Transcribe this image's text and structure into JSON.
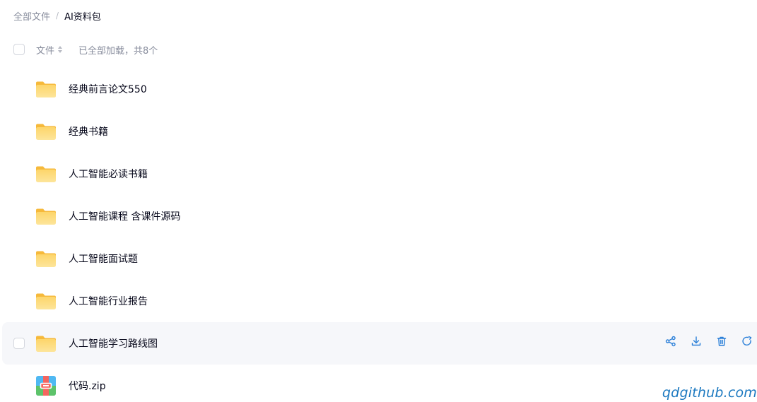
{
  "breadcrumb": {
    "parent": "全部文件",
    "separator": "/",
    "current": "AI资料包"
  },
  "header": {
    "file_column": "文件",
    "status": "已全部加载，共8个"
  },
  "files": [
    {
      "name": "经典前言论文550",
      "type": "folder"
    },
    {
      "name": "经典书籍",
      "type": "folder"
    },
    {
      "name": "人工智能必读书籍",
      "type": "folder"
    },
    {
      "name": "人工智能课程 含课件源码",
      "type": "folder"
    },
    {
      "name": "人工智能面试题",
      "type": "folder"
    },
    {
      "name": "人工智能行业报告",
      "type": "folder"
    },
    {
      "name": "人工智能学习路线图",
      "type": "folder",
      "hovered": true
    },
    {
      "name": "代码.zip",
      "type": "zip"
    }
  ],
  "row_actions": [
    "share-icon",
    "download-icon",
    "delete-icon",
    "more-icon"
  ],
  "watermark": "qdgithub.com",
  "colors": {
    "accent": "#2a7fd8",
    "folder": "#fcc84d",
    "hover_bg": "#f6f7fa",
    "text_primary": "#06071a",
    "text_secondary": "#878c9c"
  }
}
